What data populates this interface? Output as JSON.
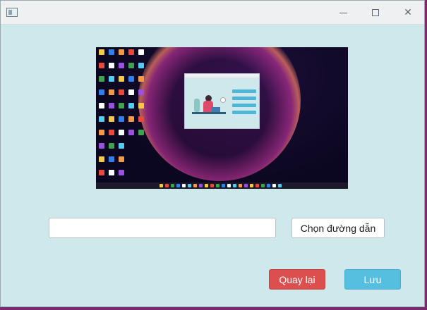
{
  "window": {
    "icons": {
      "app": "app-window-icon",
      "minimize": "minimize-icon",
      "maximize": "maximize-icon",
      "close": "close-icon"
    },
    "close_glyph": "✕"
  },
  "preview": {
    "image": "desktop-screenshot-preview"
  },
  "path": {
    "value": "",
    "placeholder": ""
  },
  "buttons": {
    "choose_path_label": "Chọn đường dẫn",
    "back_label": "Quay lại",
    "save_label": "Lưu"
  },
  "colors": {
    "background": "#cfe8eb",
    "back_button": "#dc4f4f",
    "save_button": "#56bfe0"
  }
}
